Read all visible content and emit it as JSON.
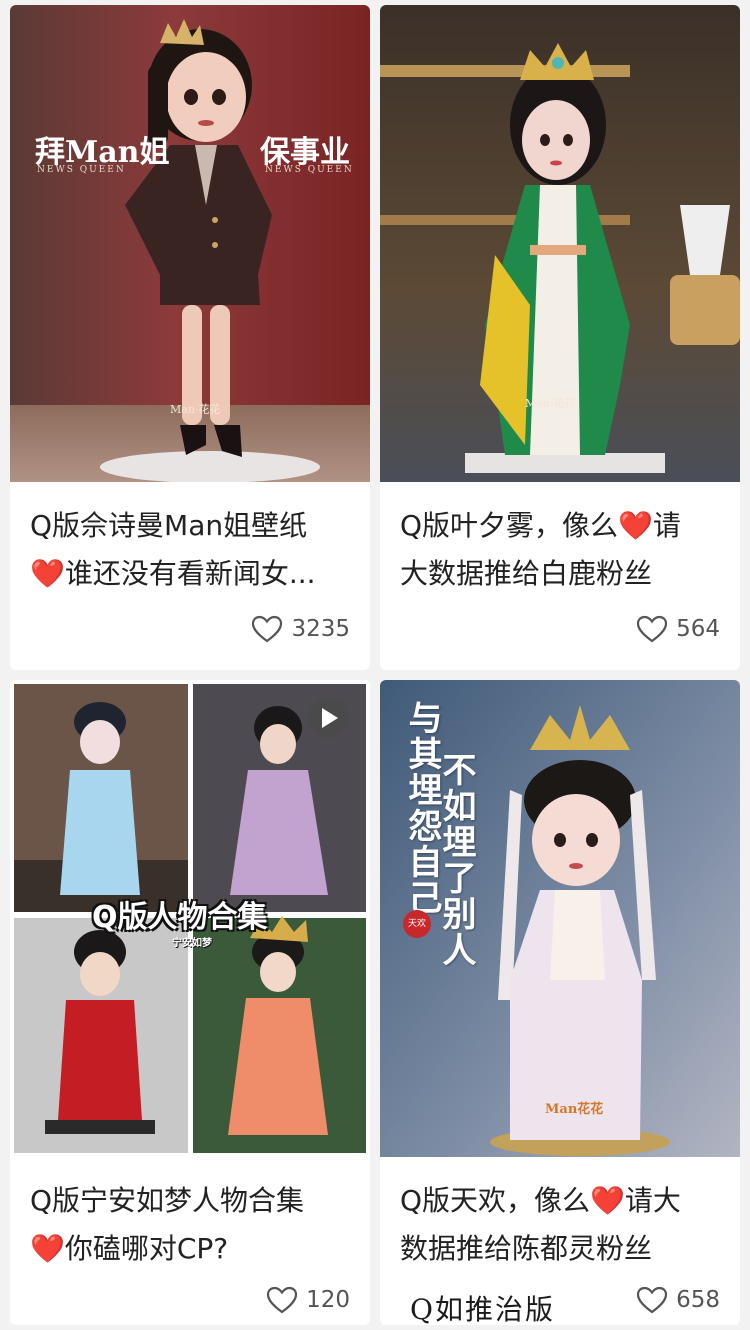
{
  "cards": [
    {
      "title_line1": "Q版佘诗曼Man姐壁纸",
      "title_line2": "谁还没有看新闻女...",
      "likes": "3235",
      "image": {
        "left_text": "拜Man姐",
        "right_text": "保事业",
        "left_sub": "NEWS QUEEN",
        "right_sub": "NEWS QUEEN",
        "watermark": "Man·花花"
      }
    },
    {
      "title_line1_a": "Q版叶夕雾，像么",
      "title_line1_b": "请",
      "title_line2": "大数据推给白鹿粉丝",
      "likes": "564",
      "image": {
        "watermark": "Man·花花"
      }
    },
    {
      "title_line1": "Q版宁安如梦人物合集",
      "title_line2": "你磕哪对CP?",
      "likes": "120",
      "image": {
        "overlay": "Q版人物合集",
        "overlay_sub": "宁安如梦"
      }
    },
    {
      "title_line1_a": "Q版天欢，像么",
      "title_line1_b": "请大",
      "title_line2": "数据推给陈都灵粉丝",
      "likes": "658",
      "image": {
        "vtext_right": "与其埋怨自己",
        "vtext_left": "不如埋了别人",
        "seal": "天欢",
        "watermark": "Man花花"
      }
    }
  ],
  "footer_overlay": "Q如推治版",
  "colors": {
    "heart": "#e8291c",
    "background": "#f2f2f2",
    "card": "#ffffff"
  },
  "icons": {
    "like": "heart-outline-icon",
    "inline_heart": "red-heart-emoji-icon",
    "play": "play-icon"
  }
}
